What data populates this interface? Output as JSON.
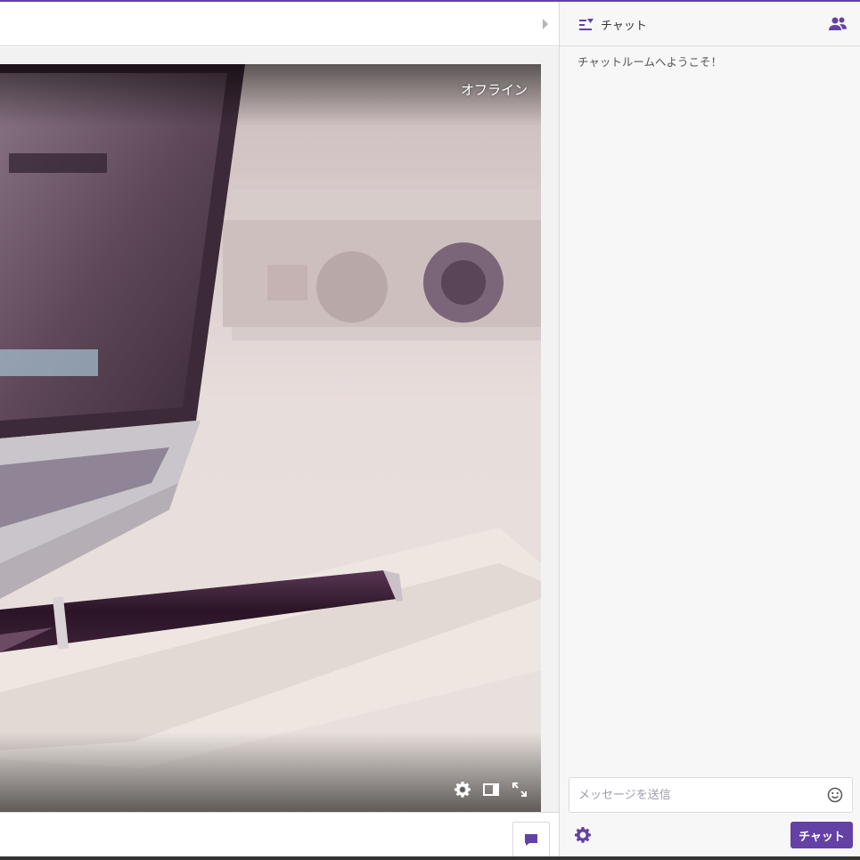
{
  "player": {
    "status_label": "オフライン",
    "controls": [
      "settings-icon",
      "theatre-mode-icon",
      "fullscreen-icon"
    ]
  },
  "chat": {
    "header_title": "チャット",
    "welcome_message": "チャットルームへようこそ！",
    "input_placeholder": "メッセージを送信",
    "send_label": "チャット"
  },
  "colors": {
    "accent": "#6441a4",
    "border": "#dad8de",
    "chat_bg": "#f7f7f8"
  }
}
